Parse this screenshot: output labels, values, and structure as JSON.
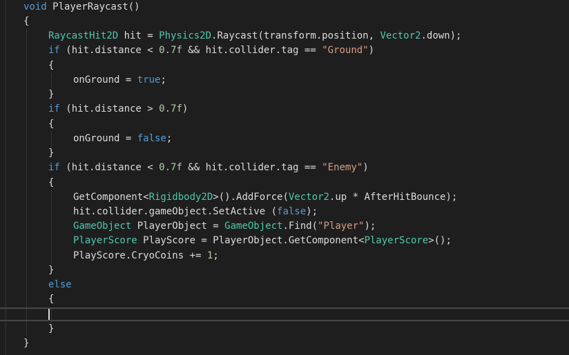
{
  "code_lines": [
    [
      {
        "t": "void",
        "c": "kw"
      },
      {
        "t": " PlayerRaycast()",
        "c": "pl"
      }
    ],
    [
      {
        "t": "{",
        "c": "pl"
      }
    ],
    [
      {
        "t": "RaycastHit2D",
        "c": "ty"
      },
      {
        "t": " hit = ",
        "c": "pl"
      },
      {
        "t": "Physics2D",
        "c": "ty"
      },
      {
        "t": ".Raycast(transform.position, ",
        "c": "pl"
      },
      {
        "t": "Vector2",
        "c": "ty"
      },
      {
        "t": ".down);",
        "c": "pl"
      }
    ],
    [
      {
        "t": "if",
        "c": "kw"
      },
      {
        "t": " (hit.distance < ",
        "c": "pl"
      },
      {
        "t": "0.7f",
        "c": "num"
      },
      {
        "t": " && hit.collider.tag == ",
        "c": "pl"
      },
      {
        "t": "\"Ground\"",
        "c": "str"
      },
      {
        "t": ")",
        "c": "pl"
      }
    ],
    [
      {
        "t": "{",
        "c": "pl"
      }
    ],
    [
      {
        "t": "onGround = ",
        "c": "pl"
      },
      {
        "t": "true",
        "c": "kw"
      },
      {
        "t": ";",
        "c": "pl"
      }
    ],
    [
      {
        "t": "}",
        "c": "pl"
      }
    ],
    [
      {
        "t": "if",
        "c": "kw"
      },
      {
        "t": " (hit.distance > ",
        "c": "pl"
      },
      {
        "t": "0.7f",
        "c": "num"
      },
      {
        "t": ")",
        "c": "pl"
      }
    ],
    [
      {
        "t": "{",
        "c": "pl"
      }
    ],
    [
      {
        "t": "onGround = ",
        "c": "pl"
      },
      {
        "t": "false",
        "c": "kw"
      },
      {
        "t": ";",
        "c": "pl"
      }
    ],
    [
      {
        "t": "}",
        "c": "pl"
      }
    ],
    [
      {
        "t": "if",
        "c": "kw"
      },
      {
        "t": " (hit.distance < ",
        "c": "pl"
      },
      {
        "t": "0.7f",
        "c": "num"
      },
      {
        "t": " && hit.collider.tag == ",
        "c": "pl"
      },
      {
        "t": "\"Enemy\"",
        "c": "str"
      },
      {
        "t": ")",
        "c": "pl"
      }
    ],
    [
      {
        "t": "{",
        "c": "pl"
      }
    ],
    [
      {
        "t": "GetComponent<",
        "c": "pl"
      },
      {
        "t": "Rigidbody2D",
        "c": "ty"
      },
      {
        "t": ">().AddForce(",
        "c": "pl"
      },
      {
        "t": "Vector2",
        "c": "ty"
      },
      {
        "t": ".up * AfterHitBounce);",
        "c": "pl"
      }
    ],
    [
      {
        "t": "hit.collider.gameObject.SetActive (",
        "c": "pl"
      },
      {
        "t": "false",
        "c": "kw"
      },
      {
        "t": ");",
        "c": "pl"
      }
    ],
    [
      {
        "t": "GameObject",
        "c": "ty"
      },
      {
        "t": " PlayerObject = ",
        "c": "pl"
      },
      {
        "t": "GameObject",
        "c": "ty"
      },
      {
        "t": ".Find(",
        "c": "pl"
      },
      {
        "t": "\"Player\"",
        "c": "str"
      },
      {
        "t": ");",
        "c": "pl"
      }
    ],
    [
      {
        "t": "PlayerScore",
        "c": "ty"
      },
      {
        "t": " PlayScore = PlayerObject.GetComponent<",
        "c": "pl"
      },
      {
        "t": "PlayerScore",
        "c": "ty"
      },
      {
        "t": ">();",
        "c": "pl"
      }
    ],
    [
      {
        "t": "PlayScore.CryoCoins += ",
        "c": "pl"
      },
      {
        "t": "1",
        "c": "num"
      },
      {
        "t": ";",
        "c": "pl"
      }
    ],
    [
      {
        "t": "}",
        "c": "pl"
      }
    ],
    [
      {
        "t": "else",
        "c": "kw"
      }
    ],
    [
      {
        "t": "{",
        "c": "pl"
      }
    ],
    [],
    [
      {
        "t": "}",
        "c": "pl"
      }
    ],
    [
      {
        "t": "}",
        "c": "pl"
      }
    ]
  ],
  "colors": {
    "background": "#1e1e1e",
    "keyword": "#569cd6",
    "type": "#4ec9b0",
    "string": "#d69d85",
    "number": "#b5cea8",
    "plain": "#dcdcdc"
  }
}
